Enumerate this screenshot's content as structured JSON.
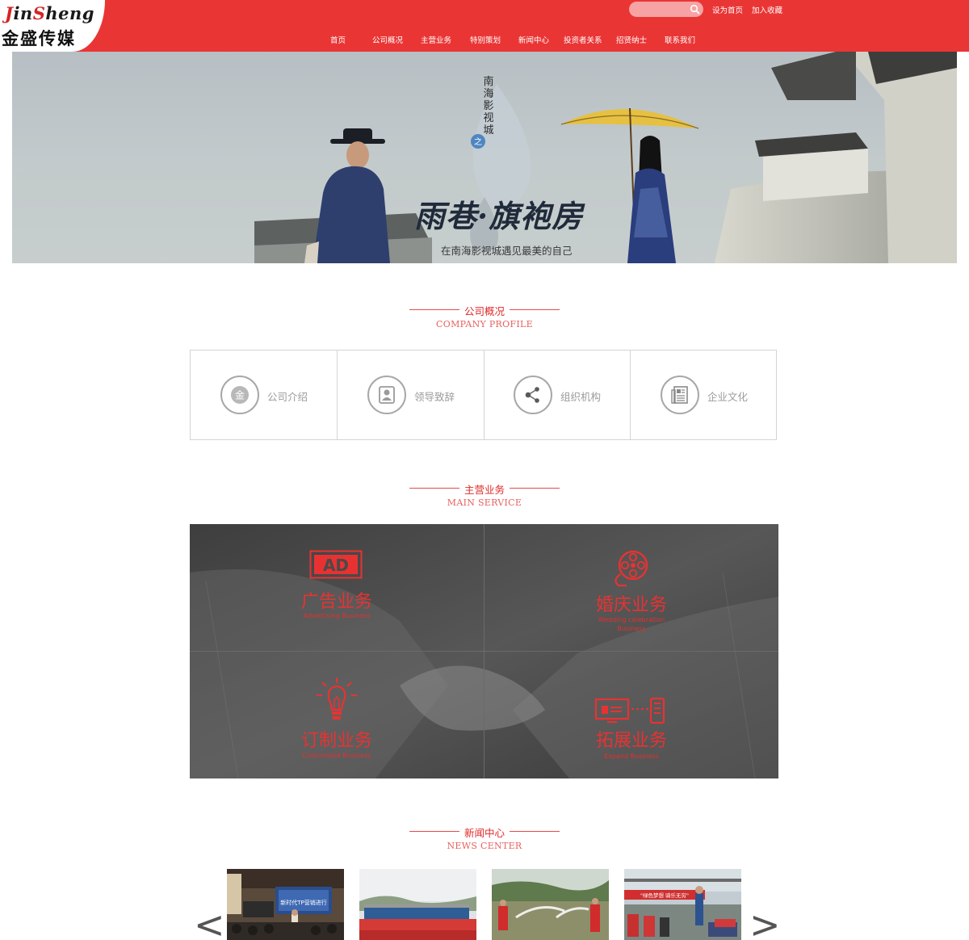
{
  "header": {
    "logo_en_first": "J",
    "logo_en_mid": "in",
    "logo_en_s": "S",
    "logo_en_last": "heng",
    "logo_cn": "金盛传媒",
    "search": {
      "value": "",
      "placeholder": ""
    },
    "top_links": [
      "设为首页",
      "加入收藏"
    ],
    "nav": [
      "首页",
      "公司概况",
      "主营业务",
      "特别策划",
      "新闻中心",
      "投资者关系",
      "招贤纳士",
      "联系我们"
    ],
    "accent_color": "#ea3535"
  },
  "banner": {
    "vertical_text": [
      "南",
      "海",
      "影",
      "视",
      "城"
    ],
    "badge": "之",
    "title": "雨巷·旗袍房",
    "subtitle": "在南海影视城遇见最美的自己"
  },
  "sections": {
    "profile": {
      "cn": "公司概况",
      "en": "COMPANY PROFILE"
    },
    "service": {
      "cn": "主营业务",
      "en": "MAIN SERVICE"
    },
    "news": {
      "cn": "新闻中心",
      "en": "NEWS CENTER"
    }
  },
  "profile_cards": [
    {
      "label": "公司介绍",
      "icon": "company-intro-icon",
      "glyph": "金"
    },
    {
      "label": "领导致辞",
      "icon": "leader-icon"
    },
    {
      "label": "组织机构",
      "icon": "organization-icon"
    },
    {
      "label": "企业文化",
      "icon": "culture-icon"
    }
  ],
  "services": [
    {
      "cn": "广告业务",
      "en": [
        "Advertising Business"
      ],
      "icon": "ad-icon",
      "icon_text": "AD"
    },
    {
      "cn": "婚庆业务",
      "en": [
        "Wedding celebration",
        "Business"
      ],
      "icon": "film-reel-icon"
    },
    {
      "cn": "订制业务",
      "en": [
        "Customized Business"
      ],
      "icon": "lightbulb-icon"
    },
    {
      "cn": "拓展业务",
      "en": [
        "Expand Business"
      ],
      "icon": "monitor-phone-icon"
    }
  ],
  "news": {
    "prev": "<",
    "next": ">",
    "items": [
      {
        "caption": "新时代TP营销进行"
      },
      {
        "caption": ""
      },
      {
        "caption": ""
      },
      {
        "caption": "\"绿色梦想 骑乐无穷\""
      }
    ]
  }
}
